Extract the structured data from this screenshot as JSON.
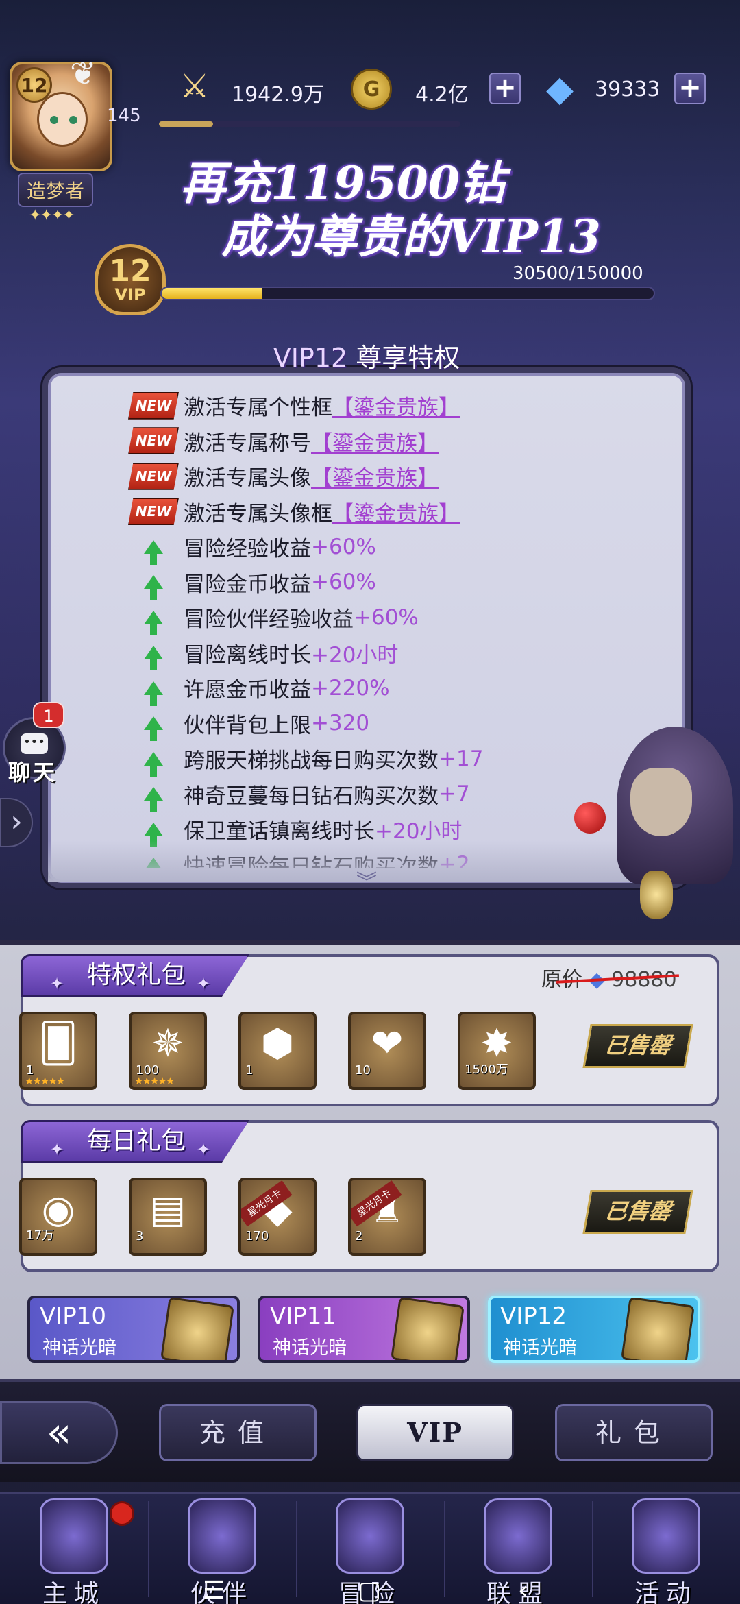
{
  "player": {
    "level": "12",
    "avatar_number": "145",
    "title": "造梦者",
    "power": "1942.9万",
    "gold": "4.2亿",
    "diamonds": "39333"
  },
  "promo": {
    "line1": "再充119500钻",
    "line2": "成为尊贵的VIP13",
    "vip_level": "12",
    "vip_label": "VIP",
    "exp_text": "30500/150000",
    "exp_fraction": 0.2033
  },
  "privileges": {
    "title_vip": "VIP12",
    "title_text": "尊享特权",
    "items": [
      {
        "type": "new",
        "text": "激活专属个性框",
        "value": "【鎏金贵族】"
      },
      {
        "type": "new",
        "text": "激活专属称号",
        "value": "【鎏金贵族】"
      },
      {
        "type": "new",
        "text": "激活专属头像",
        "value": "【鎏金贵族】"
      },
      {
        "type": "new",
        "text": "激活专属头像框",
        "value": "【鎏金贵族】"
      },
      {
        "type": "up",
        "text": "冒险经验收益",
        "value": "+60%"
      },
      {
        "type": "up",
        "text": "冒险金币收益",
        "value": "+60%"
      },
      {
        "type": "up",
        "text": "冒险伙伴经验收益",
        "value": "+60%"
      },
      {
        "type": "up",
        "text": "冒险离线时长",
        "value": "+20小时"
      },
      {
        "type": "up",
        "text": "许愿金币收益",
        "value": "+220%"
      },
      {
        "type": "up",
        "text": "伙伴背包上限",
        "value": "+320"
      },
      {
        "type": "up",
        "text": "跨服天梯挑战每日购买次数",
        "value": "+17"
      },
      {
        "type": "up",
        "text": "神奇豆蔓每日钻石购买次数",
        "value": "+7"
      },
      {
        "type": "up",
        "text": "保卫童话镇离线时长",
        "value": "+20小时"
      },
      {
        "type": "up",
        "text": "快速冒险每日钻石购买次数",
        "value": "+2"
      }
    ],
    "new_tag": "NEW"
  },
  "chat": {
    "badge": "1",
    "label": "聊天"
  },
  "privilege_pack": {
    "title": "特权礼包",
    "original_label": "原价",
    "original_price": "98880",
    "sold_label": "已售罄",
    "items": [
      {
        "icon": "card-icon",
        "qty": "1",
        "stars": "★★★★★"
      },
      {
        "icon": "compass-icon",
        "qty": "100",
        "stars": "★★★★★"
      },
      {
        "icon": "hex-coin-icon",
        "qty": "1",
        "stars": ""
      },
      {
        "icon": "hearts-icon",
        "qty": "10",
        "stars": ""
      },
      {
        "icon": "exp-star-icon",
        "qty": "1500万",
        "stars": ""
      }
    ]
  },
  "daily_pack": {
    "title": "每日礼包",
    "sold_label": "已售罄",
    "items": [
      {
        "icon": "gold-coin-icon",
        "qty": "17万",
        "ribbon": ""
      },
      {
        "icon": "scroll-icon",
        "qty": "3",
        "ribbon": ""
      },
      {
        "icon": "diamond-icon",
        "qty": "170",
        "ribbon": "星光月卡"
      },
      {
        "icon": "hooded-figure-icon",
        "qty": "2",
        "ribbon": "星光月卡"
      }
    ]
  },
  "vip_tabs": [
    {
      "level": "VIP10",
      "name": "神话光暗"
    },
    {
      "level": "VIP11",
      "name": "神话光暗"
    },
    {
      "level": "VIP12",
      "name": "神话光暗"
    }
  ],
  "nav_tabs": [
    "充值",
    "VIP",
    "礼包"
  ],
  "bottom_tabs": [
    "主城",
    "伙伴",
    "冒险",
    "联盟",
    "活动"
  ],
  "colors": {
    "accent_purple": "#8d66d6",
    "exp_yellow": "#f6cf2c",
    "vip12_tab": "#2aa7d9"
  }
}
